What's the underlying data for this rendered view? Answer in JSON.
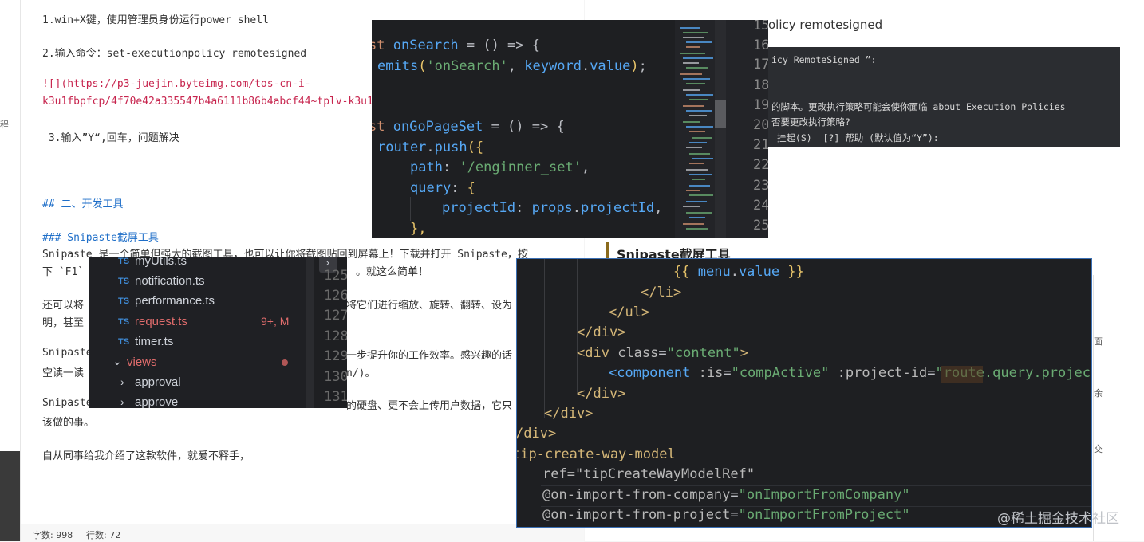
{
  "editor": {
    "line1": "1.win+X键，使用管理员身份运行power shell",
    "line2": "2.输入命令：set-executionpolicy remotesigned",
    "link_a": "![](https://p3-juejin.byteimg.com/tos-cn-i-",
    "link_b": "k3u1fbpfcp/4f70e42a335547b4a6111b86b4abcf44~tplv-k3u1f",
    "line3": " 3.输入”Y“,回车，问题解决",
    "h2": "## 二、开发工具",
    "h3": "### Snipaste截屏工具",
    "para1a": "Snipaste 是一个简单但强大的截图工具，也可以让你将截图贴回到屏幕上！下载并打开 Snipaste，按",
    "para1b": "下 `F1`",
    "para1c": "。就这么简单！",
    "para2a": "还可以将",
    "para2b": "将它们进行缩放、旋转、翻转、设为",
    "para2c": "明，甚至",
    "para3a": "Snipaste",
    "para3b": "一步提升你的工作效率。感兴趣的话",
    "para3c": "空读一读",
    "para3d": "n/)。",
    "para4a": "Snipaste",
    "para4b": "的硬盘、更不会上传用户数据，它只",
    "para4c": "该做的事。",
    "para5": "自从同事给我介绍了这款软件，就爱不释手，",
    "side_char": "程"
  },
  "statusbar": {
    "word_count": "字数: 998",
    "line_count": "行数: 72"
  },
  "article": {
    "top_text": "olicy remotesigned",
    "heading": "Snipaste截屏工具",
    "side_chars": [
      "面",
      "余",
      "交"
    ]
  },
  "powershell": {
    "l1": "icy RemoteSigned ”:",
    "l2": "的脚本。更改执行策略可能会使你面临 about_Execution_Policies",
    "l3": "否要更改执行策略?",
    "l4": " 挂起(S)  [?] 帮助 (默认值为“Y”):"
  },
  "vs1": {
    "line_numbers": [
      "15",
      "16",
      "17",
      "18",
      "19",
      "20",
      "21",
      "22",
      "23",
      "24",
      "25"
    ],
    "code": {
      "l1_kw": "st",
      "l1_fn": "onSearch",
      "l1_rest": " = () => {",
      "l2_fn": "emits",
      "l2_str": "'onSearch'",
      "l2_id": "keyword",
      "l2_prop": "value",
      "l4_kw": "st",
      "l4_fn": "onGoPageSet",
      "l4_rest": " = () => {",
      "l5_id": "router",
      "l5_fn": "push",
      "l6_prop": "path",
      "l6_str": "'/enginner_set'",
      "l7_prop": "query",
      "l8_prop": "projectId",
      "l8_id": "props",
      "l8_prop2": "projectId",
      "l9": "},"
    }
  },
  "vs2": {
    "files": [
      {
        "name": "myUtils.ts",
        "badge": ""
      },
      {
        "name": "notification.ts",
        "badge": ""
      },
      {
        "name": "performance.ts",
        "badge": ""
      },
      {
        "name": "request.ts",
        "badge": "9+, M"
      },
      {
        "name": "timer.ts",
        "badge": ""
      }
    ],
    "folder": "views",
    "subfolders": [
      "approval",
      "approve"
    ],
    "ts_label": "TS",
    "line_numbers": [
      "125",
      "126",
      "127",
      "128",
      "129",
      "130",
      "131"
    ],
    "colors": {
      "modified": "#e06c6c",
      "ts": "#3f8bd6"
    }
  },
  "vs3": {
    "menu_value": "{{ menu.value }}",
    "li_close": "</li>",
    "ul_close": "</ul>",
    "div_close": "</div>",
    "div_open": "<div",
    "class_attr": "class",
    "class_val": "\"content\"",
    "component": "<component",
    "is_attr": ":is",
    "is_val": "\"compActive\"",
    "pid_attr": ":project-id",
    "pid_val": "\"route.query.project",
    "div_close2": "</div>",
    "div_close3": "</div>",
    "div_close4": "/div>",
    "tip_tag": "tip-create-way-model",
    "ref_line": "ref=\"tipCreateWayModelRef\"",
    "on1_attr": "@on-import-from-company",
    "on1_val": "\"onImportFromCompany\"",
    "on2_attr": "@on-import-from-project",
    "on2_val": "\"onImportFromProject\""
  },
  "watermark": "@稀土掘金技术社区"
}
